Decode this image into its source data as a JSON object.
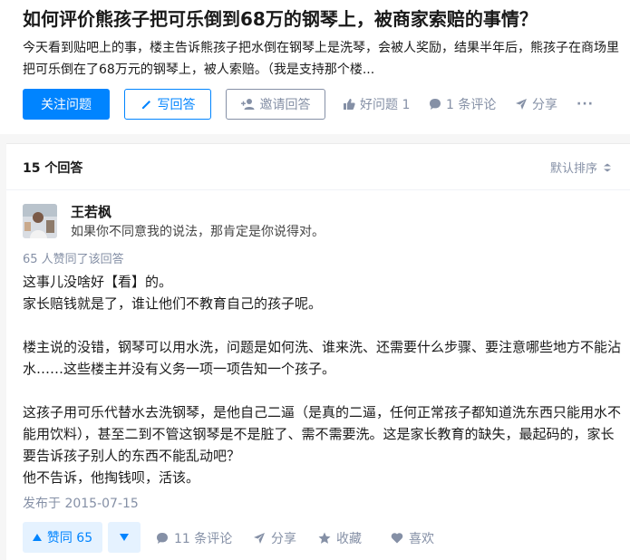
{
  "question": {
    "title": "如何评价熊孩子把可乐倒到68万的钢琴上，被商家索赔的事情？",
    "excerpt": "今天看到贴吧上的事，楼主告诉熊孩子把水倒在钢琴上是洗琴，会被人奖励，结果半年后，熊孩子在商场里把可乐倒在了68万元的钢琴上，被人索赔。（我是支持那个楼..."
  },
  "actions": {
    "follow_label": "关注问题",
    "write_label": "写回答",
    "invite_label": "邀请回答",
    "good_question_label": "好问题 1",
    "comment_label": "1 条评论",
    "share_label": "分享",
    "more_label": "···"
  },
  "answers_header": {
    "count_label": "15 个回答",
    "sort_label": "默认排序"
  },
  "answer": {
    "author_name": "王若枫",
    "author_bio": "如果你不同意我的说法，那肯定是你说得对。",
    "votes_line": "65 人赞同了该回答",
    "paragraphs": [
      "这事儿没啥好【看】的。",
      "家长赔钱就是了，谁让他们不教育自己的孩子呢。",
      "",
      "楼主说的没错，钢琴可以用水洗，问题是如何洗、谁来洗、还需要什么步骤、要注意哪些地方不能沾水……这些楼主并没有义务一项一项告知一个孩子。",
      "",
      "这孩子用可乐代替水去洗钢琴，是他自己二逼（是真的二逼，任何正常孩子都知道洗东西只能用水不能用饮料），甚至二到不管这钢琴是不是脏了、需不需要洗。这是家长教育的缺失，最起码的，家长要告诉孩子别人的东西不能乱动吧？",
      "他不告诉，他掏钱呗，活该。"
    ],
    "published": "发布于 2015-07-15",
    "vote_up_label": "赞同 65",
    "comments_label": "11 条评论",
    "share_label": "分享",
    "collect_label": "收藏",
    "like_label": "喜欢"
  },
  "colors": {
    "brand": "#0084ff",
    "muted": "#8590a6",
    "vote_bg": "#e5f2ff"
  }
}
